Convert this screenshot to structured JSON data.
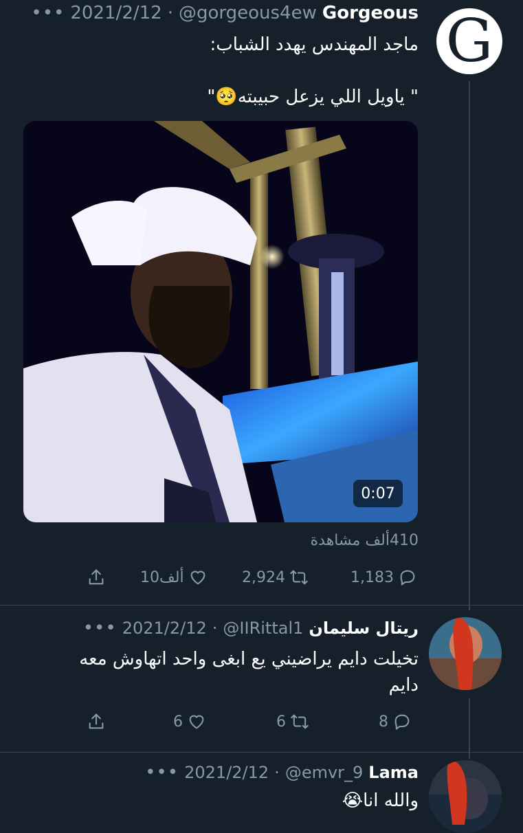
{
  "tweets": [
    {
      "name": "Gorgeous",
      "handle": "@gorgeous4ew",
      "separator": "·",
      "date": "2021/2/12",
      "avatar_letter": "G",
      "text_line1": "ماجد المهندس يهدد الشباب:",
      "text_line2": "\" ياويل اللي يزعل حبيبته🥺\"",
      "media": {
        "duration": "0:07"
      },
      "views": "410ألف مشاهدة",
      "replies": "1,183",
      "retweets": "2,924",
      "likes": "10ألف"
    },
    {
      "name": "ريتال سليمان",
      "handle": "@IIRittal1",
      "separator": "·",
      "date": "2021/2/12",
      "text_line1": "تخيلت دايم يراضيني يع ابغى واحد اتهاوش معه",
      "text_line2": "دايم",
      "replies": "8",
      "retweets": "6",
      "likes": "6"
    },
    {
      "name": "Lama",
      "handle": "@emvr_9",
      "separator": "·",
      "date": "2021/2/12",
      "text_line1": "والله انا😭"
    }
  ],
  "icons": {
    "more": "more-icon",
    "reply": "reply-icon",
    "retweet": "retweet-icon",
    "like": "heart-icon",
    "share": "share-icon"
  },
  "colors": {
    "background": "#15202b",
    "muted": "#8899a6",
    "divider": "#38444d",
    "text": "#ffffff"
  }
}
